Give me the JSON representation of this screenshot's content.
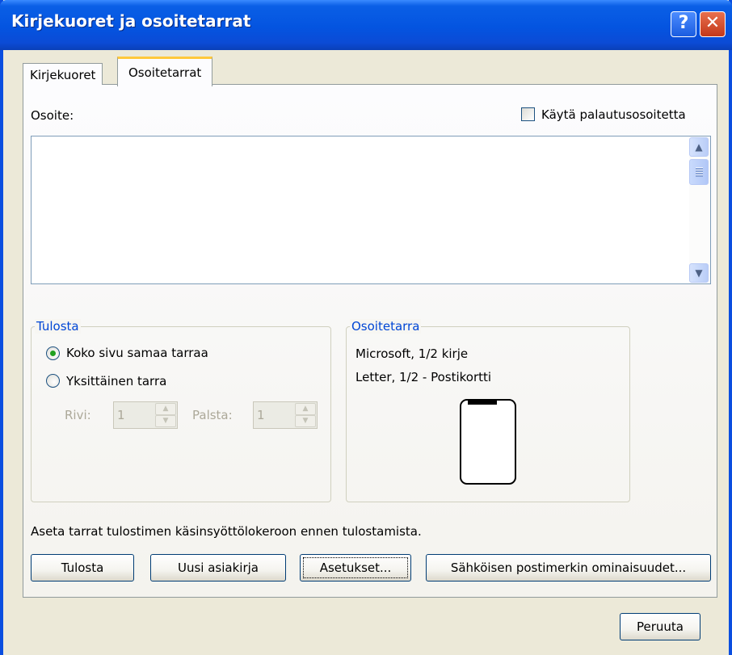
{
  "window": {
    "title": "Kirjekuoret ja osoitetarrat"
  },
  "tabs": [
    {
      "label": "Kirjekuoret",
      "active": false
    },
    {
      "label": "Osoitetarrat",
      "active": true
    }
  ],
  "address": {
    "label": "Osoite:",
    "value": "",
    "use_return_address_label": "Käytä palautusosoitetta",
    "use_return_address_checked": false
  },
  "print_group": {
    "legend": "Tulosta",
    "options": [
      {
        "label": "Koko sivu samaa tarraa",
        "selected": true
      },
      {
        "label": "Yksittäinen tarra",
        "selected": false
      }
    ],
    "row_label": "Rivi:",
    "row_value": "1",
    "column_label": "Palsta:",
    "column_value": "1"
  },
  "label_group": {
    "legend": "Osoitetarra",
    "vendor": "Microsoft, 1/2 kirje",
    "product": "Letter, 1/2 - Postikortti"
  },
  "footnote": "Aseta tarrat tulostimen käsinsyöttölokeroon ennen tulostamista.",
  "buttons": {
    "print": "Tulosta",
    "new_document": "Uusi asiakirja",
    "options": "Asetukset...",
    "estamp": "Sähköisen postimerkin ominaisuudet...",
    "cancel": "Peruuta"
  },
  "icons": {
    "help": "help-icon",
    "close": "close-icon",
    "scroll_up": "arrow-up-icon",
    "scroll_down": "arrow-down-icon"
  },
  "colors": {
    "titlebar": "#0454e0",
    "group_legend": "#0046d5",
    "tab_highlight": "#ffc83c"
  }
}
